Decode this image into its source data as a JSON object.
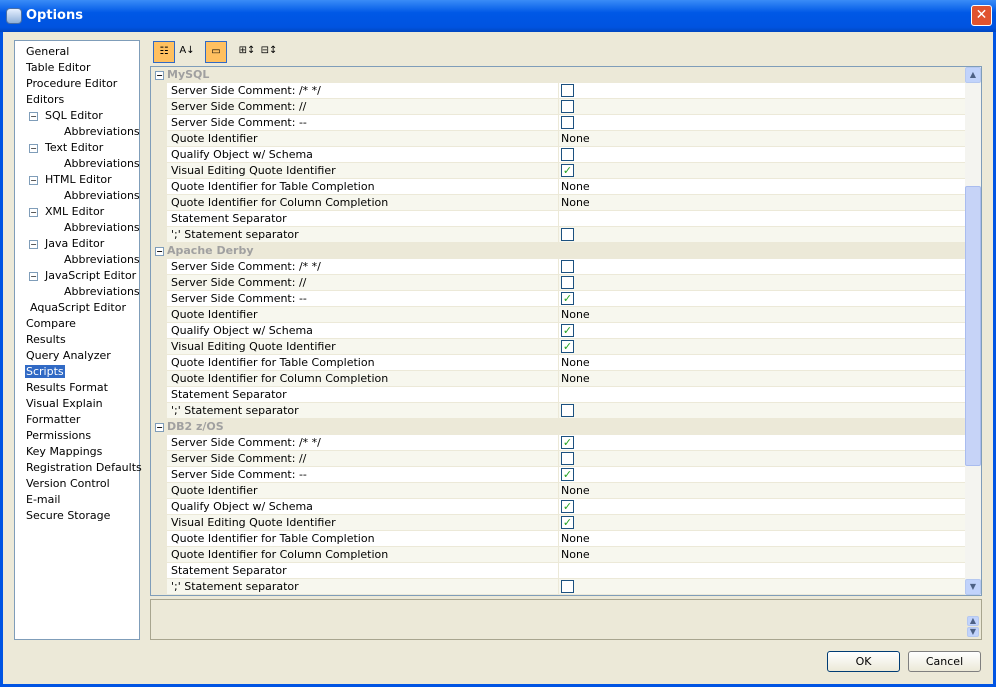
{
  "window": {
    "title": "Options",
    "close": "✕"
  },
  "tree": [
    {
      "label": "General",
      "level": 0
    },
    {
      "label": "Table Editor",
      "level": 0
    },
    {
      "label": "Procedure Editor",
      "level": 0
    },
    {
      "label": "Editors",
      "level": 0
    },
    {
      "label": "SQL Editor",
      "level": 1,
      "expander": "−"
    },
    {
      "label": "Abbreviations",
      "level": 2
    },
    {
      "label": "Text Editor",
      "level": 1,
      "expander": "−"
    },
    {
      "label": "Abbreviations",
      "level": 2
    },
    {
      "label": "HTML Editor",
      "level": 1,
      "expander": "−"
    },
    {
      "label": "Abbreviations",
      "level": 2
    },
    {
      "label": "XML Editor",
      "level": 1,
      "expander": "−"
    },
    {
      "label": "Abbreviations",
      "level": 2
    },
    {
      "label": "Java Editor",
      "level": 1,
      "expander": "−"
    },
    {
      "label": "Abbreviations",
      "level": 2
    },
    {
      "label": "JavaScript Editor",
      "level": 1,
      "expander": "−"
    },
    {
      "label": "Abbreviations",
      "level": 2
    },
    {
      "label": "AquaScript Editor",
      "level": 1
    },
    {
      "label": "Compare",
      "level": 0
    },
    {
      "label": "Results",
      "level": 0
    },
    {
      "label": "Query Analyzer",
      "level": 0
    },
    {
      "label": "Scripts",
      "level": 0,
      "selected": true
    },
    {
      "label": "Results Format",
      "level": 0
    },
    {
      "label": "Visual Explain",
      "level": 0
    },
    {
      "label": "Formatter",
      "level": 0
    },
    {
      "label": "Permissions",
      "level": 0
    },
    {
      "label": "Key Mappings",
      "level": 0
    },
    {
      "label": "Registration Defaults",
      "level": 0
    },
    {
      "label": "Version Control",
      "level": 0
    },
    {
      "label": "E-mail",
      "level": 0
    },
    {
      "label": "Secure Storage",
      "level": 0
    }
  ],
  "toolbar": [
    "categorized-icon",
    "alphabetical-icon",
    "property-pages-icon",
    "expand-all-icon",
    "collapse-all-icon"
  ],
  "groups": [
    {
      "name": "MySQL",
      "rows": [
        [
          "Server Side Comment: /* */",
          "cb",
          false
        ],
        [
          "Server Side Comment: //",
          "cb",
          false
        ],
        [
          "Server Side Comment: --",
          "cb",
          false
        ],
        [
          "Quote Identifier",
          "text",
          "None"
        ],
        [
          "Qualify Object w/ Schema",
          "cb",
          false
        ],
        [
          "Visual Editing Quote Identifier",
          "cb",
          true
        ],
        [
          "Quote Identifier for Table Completion",
          "text",
          "None"
        ],
        [
          "Quote Identifier for Column Completion",
          "text",
          "None"
        ],
        [
          "Statement Separator",
          "text",
          ""
        ],
        [
          "';' Statement separator",
          "cb",
          false
        ]
      ]
    },
    {
      "name": "Apache Derby",
      "rows": [
        [
          "Server Side Comment: /* */",
          "cb",
          false
        ],
        [
          "Server Side Comment: //",
          "cb",
          false
        ],
        [
          "Server Side Comment: --",
          "cb",
          true
        ],
        [
          "Quote Identifier",
          "text",
          "None"
        ],
        [
          "Qualify Object w/ Schema",
          "cb",
          true
        ],
        [
          "Visual Editing Quote Identifier",
          "cb",
          true
        ],
        [
          "Quote Identifier for Table Completion",
          "text",
          "None"
        ],
        [
          "Quote Identifier for Column Completion",
          "text",
          "None"
        ],
        [
          "Statement Separator",
          "text",
          ""
        ],
        [
          "';' Statement separator",
          "cb",
          false
        ]
      ]
    },
    {
      "name": "DB2 z/OS",
      "rows": [
        [
          "Server Side Comment: /* */",
          "cb",
          true
        ],
        [
          "Server Side Comment: //",
          "cb",
          false
        ],
        [
          "Server Side Comment: --",
          "cb",
          true
        ],
        [
          "Quote Identifier",
          "text",
          "None"
        ],
        [
          "Qualify Object w/ Schema",
          "cb",
          true
        ],
        [
          "Visual Editing Quote Identifier",
          "cb",
          true
        ],
        [
          "Quote Identifier for Table Completion",
          "text",
          "None"
        ],
        [
          "Quote Identifier for Column Completion",
          "text",
          "None"
        ],
        [
          "Statement Separator",
          "text",
          ""
        ],
        [
          "';' Statement separator",
          "cb",
          false
        ]
      ]
    }
  ],
  "buttons": {
    "ok": "OK",
    "cancel": "Cancel"
  }
}
